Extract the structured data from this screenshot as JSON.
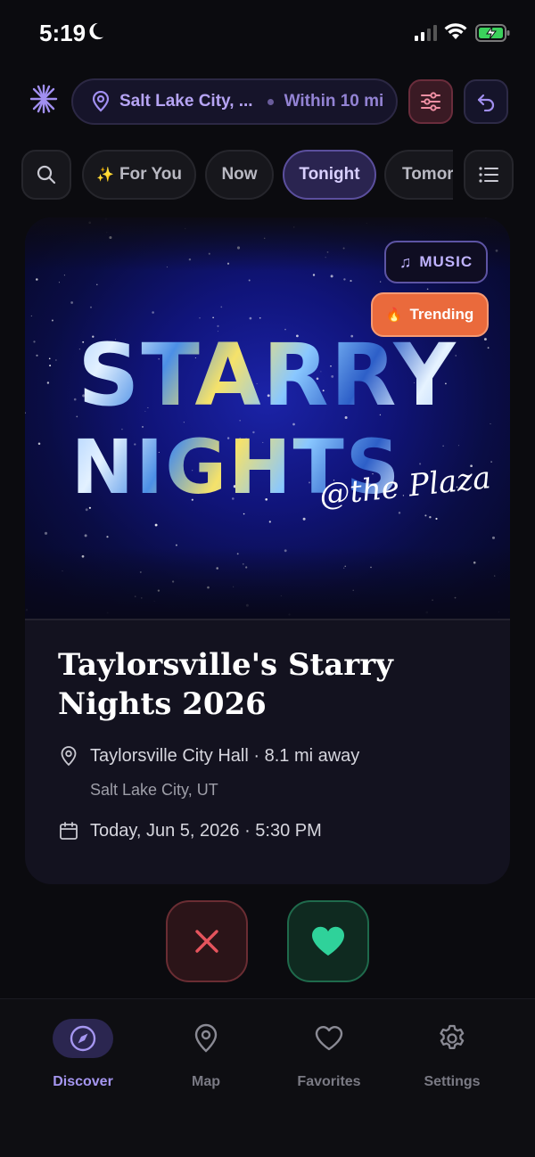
{
  "status_bar": {
    "time": "5:19"
  },
  "header": {
    "location_city": "Salt Lake City, ...",
    "location_radius": "Within 10 mi"
  },
  "chips": {
    "items": [
      {
        "label": "For You",
        "icon": "sparkles-icon"
      },
      {
        "label": "Now"
      },
      {
        "label": "Tonight",
        "active": true
      },
      {
        "label": "Tomor"
      }
    ]
  },
  "event": {
    "poster_line1": "STARRY",
    "poster_line2": "NIGHTS",
    "poster_script": "@the Plaza",
    "category": "MUSIC",
    "trending_label": "Trending",
    "title": "Taylorsville's Starry Nights 2026",
    "venue": "Taylorsville City Hall · 8.1 mi away",
    "city": "Salt Lake City, UT",
    "datetime": "Today, Jun 5, 2026 · 5:30 PM"
  },
  "colors": {
    "accent": "#a596f0",
    "reject": "#e5545d",
    "like": "#2fd29a",
    "trending": "#ea6a3c"
  },
  "tabs": [
    {
      "label": "Discover",
      "icon": "compass-icon",
      "active": true
    },
    {
      "label": "Map",
      "icon": "map-pin-icon"
    },
    {
      "label": "Favorites",
      "icon": "heart-icon"
    },
    {
      "label": "Settings",
      "icon": "gear-icon"
    }
  ]
}
